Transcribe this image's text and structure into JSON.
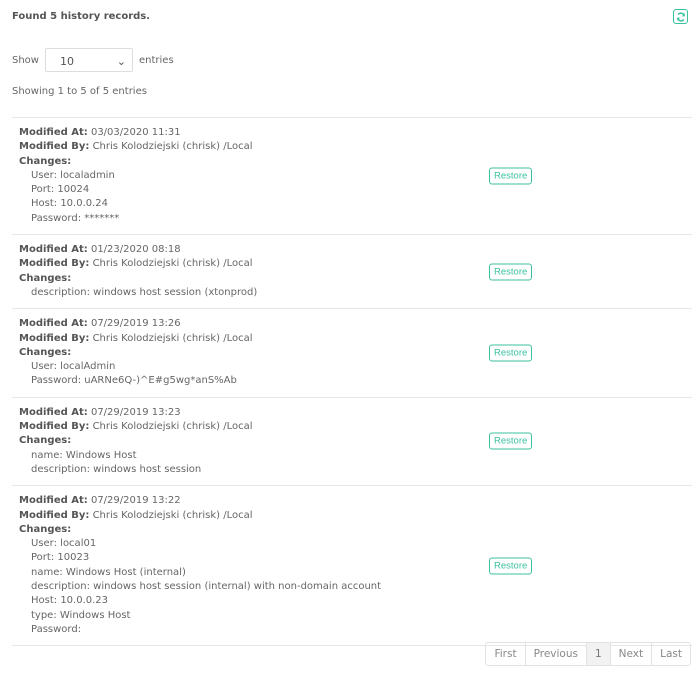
{
  "header": {
    "title": "Found 5 history records.",
    "refresh_icon": "refresh-icon"
  },
  "length": {
    "show": "Show",
    "value": "10",
    "entries": "entries"
  },
  "info": "Showing 1 to 5 of 5 entries",
  "labels": {
    "at": "Modified At:",
    "by": "Modified By:",
    "changes": "Changes:",
    "restore": "Restore"
  },
  "records": [
    {
      "at": "03/03/2020 11:31",
      "by": "Chris Kolodziejski (chrisk) /Local",
      "changes": [
        "User: localadmin",
        "Port: 10024",
        "Host: 10.0.0.24",
        "Password: *******"
      ]
    },
    {
      "at": "01/23/2020 08:18",
      "by": "Chris Kolodziejski (chrisk) /Local",
      "changes": [
        "description: windows host session (xtonprod)"
      ]
    },
    {
      "at": "07/29/2019 13:26",
      "by": "Chris Kolodziejski (chrisk) /Local",
      "changes": [
        "User: localAdmin",
        "Password: uARNe6Q-)^E#g5wg*anS%Ab"
      ]
    },
    {
      "at": "07/29/2019 13:23",
      "by": "Chris Kolodziejski (chrisk) /Local",
      "changes": [
        "name: Windows Host",
        "description: windows host session"
      ]
    },
    {
      "at": "07/29/2019 13:22",
      "by": "Chris Kolodziejski (chrisk) /Local",
      "changes": [
        "User: local01",
        "Port: 10023",
        "name: Windows Host (internal)",
        "description: windows host session (internal) with non-domain account",
        "Host: 10.0.0.23",
        "type: Windows Host",
        "Password:"
      ]
    }
  ],
  "pagination": {
    "first": "First",
    "previous": "Previous",
    "current": "1",
    "next": "Next",
    "last": "Last"
  },
  "colors": {
    "accent": "#3cc1a0"
  }
}
